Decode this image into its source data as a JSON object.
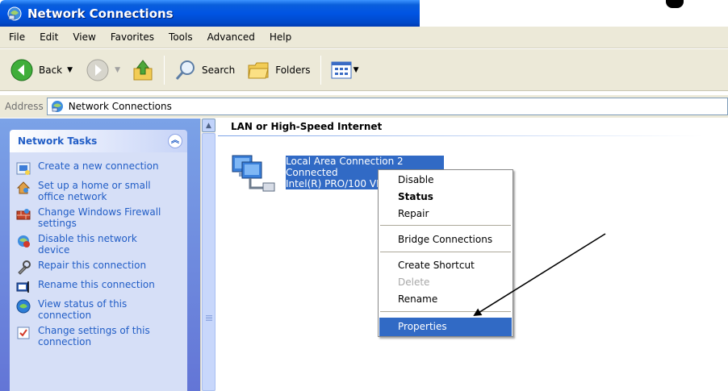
{
  "window": {
    "title": "Network Connections"
  },
  "menubar": {
    "items": [
      "File",
      "Edit",
      "View",
      "Favorites",
      "Tools",
      "Advanced",
      "Help"
    ]
  },
  "toolbar": {
    "back_label": "Back",
    "search_label": "Search",
    "folders_label": "Folders"
  },
  "address": {
    "label": "Address",
    "value": "Network Connections"
  },
  "network_tasks": {
    "title": "Network Tasks",
    "items": [
      {
        "label": "Create a new connection",
        "icon": "new-connection-icon"
      },
      {
        "label": "Set up a home or small office network",
        "icon": "home-network-icon"
      },
      {
        "label": "Change Windows Firewall settings",
        "icon": "firewall-icon"
      },
      {
        "label": "Disable this network device",
        "icon": "disable-device-icon"
      },
      {
        "label": "Repair this connection",
        "icon": "repair-icon"
      },
      {
        "label": "Rename this connection",
        "icon": "rename-icon"
      },
      {
        "label": "View status of this connection",
        "icon": "status-icon"
      },
      {
        "label": "Change settings of this connection",
        "icon": "settings-icon"
      }
    ]
  },
  "main": {
    "group_header": "LAN or High-Speed Internet",
    "connection": {
      "name": "Local Area Connection 2",
      "status": "Connected",
      "device": "Intel(R) PRO/100 VE"
    }
  },
  "context_menu": {
    "items": [
      "Disable",
      "Status",
      "Repair",
      "Bridge Connections",
      "Create Shortcut",
      "Delete",
      "Rename",
      "Properties"
    ],
    "selected": "Properties",
    "bold": "Status",
    "disabled": "Delete"
  },
  "colors": {
    "titlebar": "#0054e3",
    "selection": "#316ac5",
    "task_panel": "#d6dff7",
    "task_link": "#215dc6"
  }
}
